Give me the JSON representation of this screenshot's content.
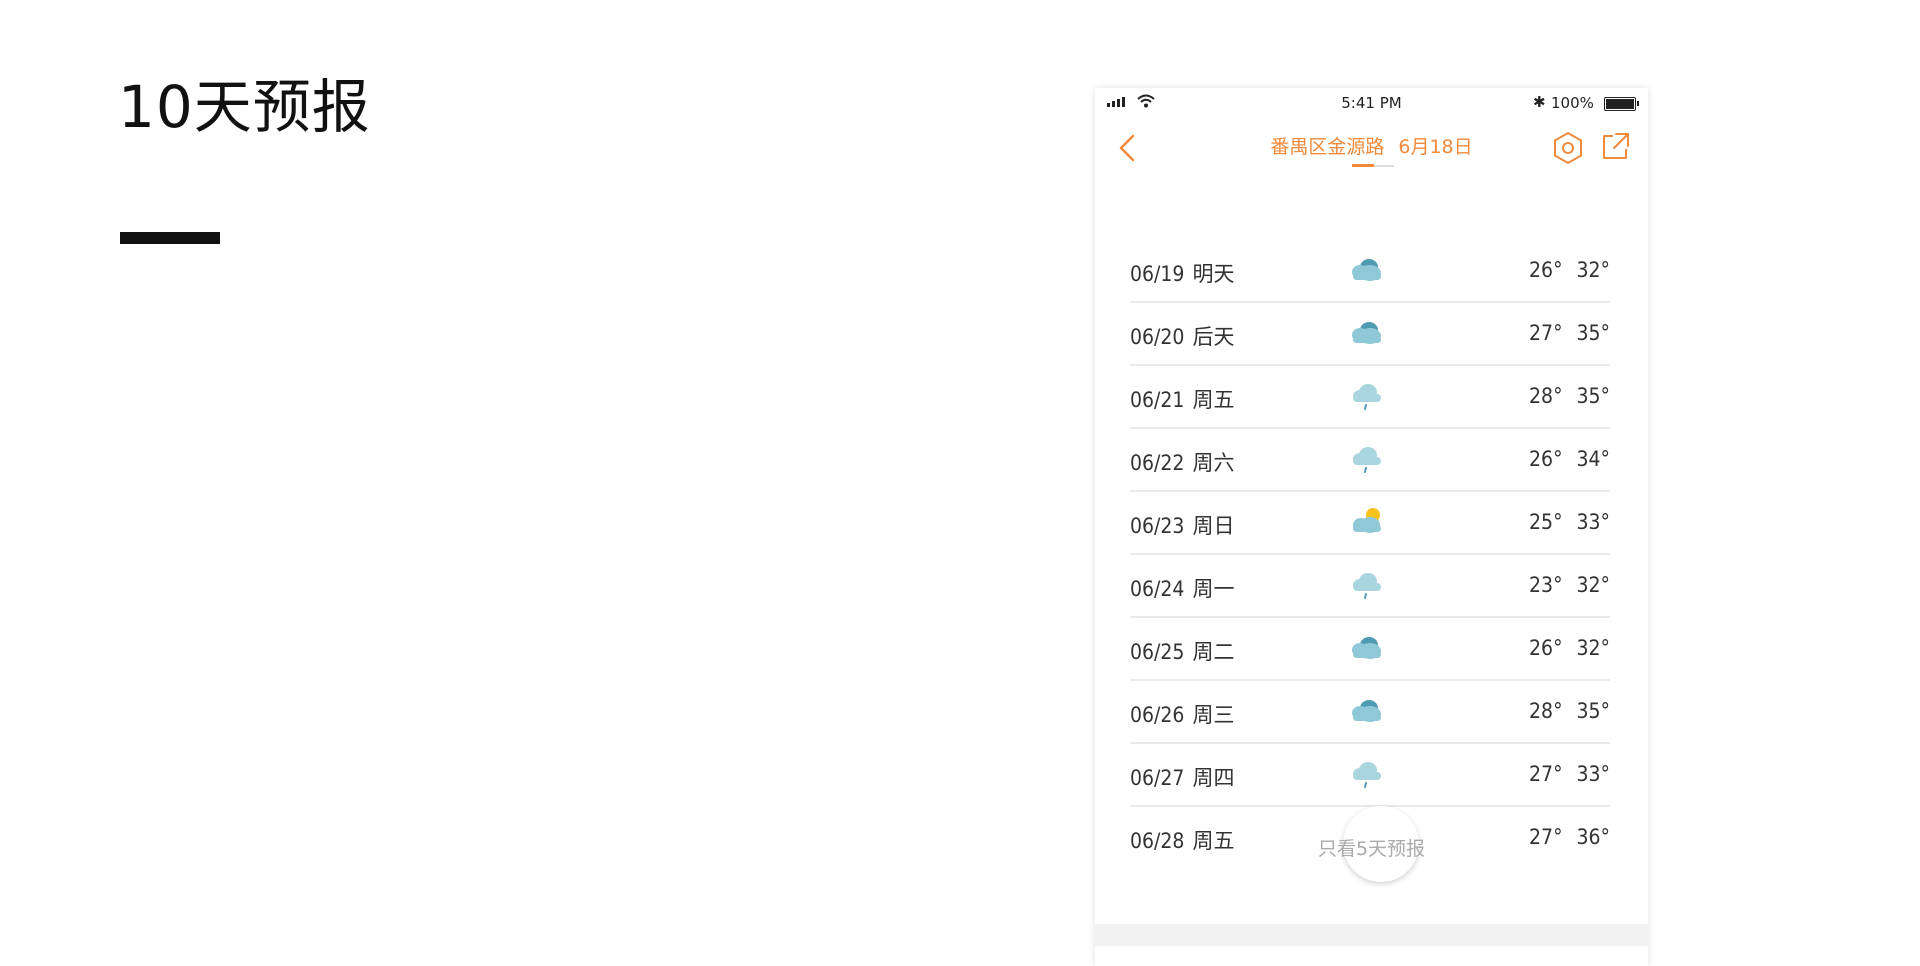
{
  "slide": {
    "title": "10天预报"
  },
  "status_bar": {
    "time": "5:41 PM",
    "bluetooth": "✱",
    "battery": "100%"
  },
  "header": {
    "location": "番禺区金源路",
    "date": "6月18日",
    "accent_color": "#f08a3c"
  },
  "forecast": [
    {
      "date": "06/19",
      "day": "明天",
      "icon": "cloudy-icon",
      "low": "26°",
      "high": "32°"
    },
    {
      "date": "06/20",
      "day": "后天",
      "icon": "cloudy-icon",
      "low": "27°",
      "high": "35°"
    },
    {
      "date": "06/21",
      "day": "周五",
      "icon": "light-rain-icon",
      "low": "28°",
      "high": "35°"
    },
    {
      "date": "06/22",
      "day": "周六",
      "icon": "light-rain-icon",
      "low": "26°",
      "high": "34°"
    },
    {
      "date": "06/23",
      "day": "周日",
      "icon": "partly-cloudy-icon",
      "low": "25°",
      "high": "33°"
    },
    {
      "date": "06/24",
      "day": "周一",
      "icon": "light-rain-icon",
      "low": "23°",
      "high": "32°"
    },
    {
      "date": "06/25",
      "day": "周二",
      "icon": "cloudy-icon",
      "low": "26°",
      "high": "32°"
    },
    {
      "date": "06/26",
      "day": "周三",
      "icon": "cloudy-icon",
      "low": "28°",
      "high": "35°"
    },
    {
      "date": "06/27",
      "day": "周四",
      "icon": "light-rain-icon",
      "low": "27°",
      "high": "33°"
    },
    {
      "date": "06/28",
      "day": "周五",
      "icon": "sunny-icon",
      "low": "27°",
      "high": "36°"
    }
  ],
  "toggle": {
    "label": "只看5天预报"
  }
}
